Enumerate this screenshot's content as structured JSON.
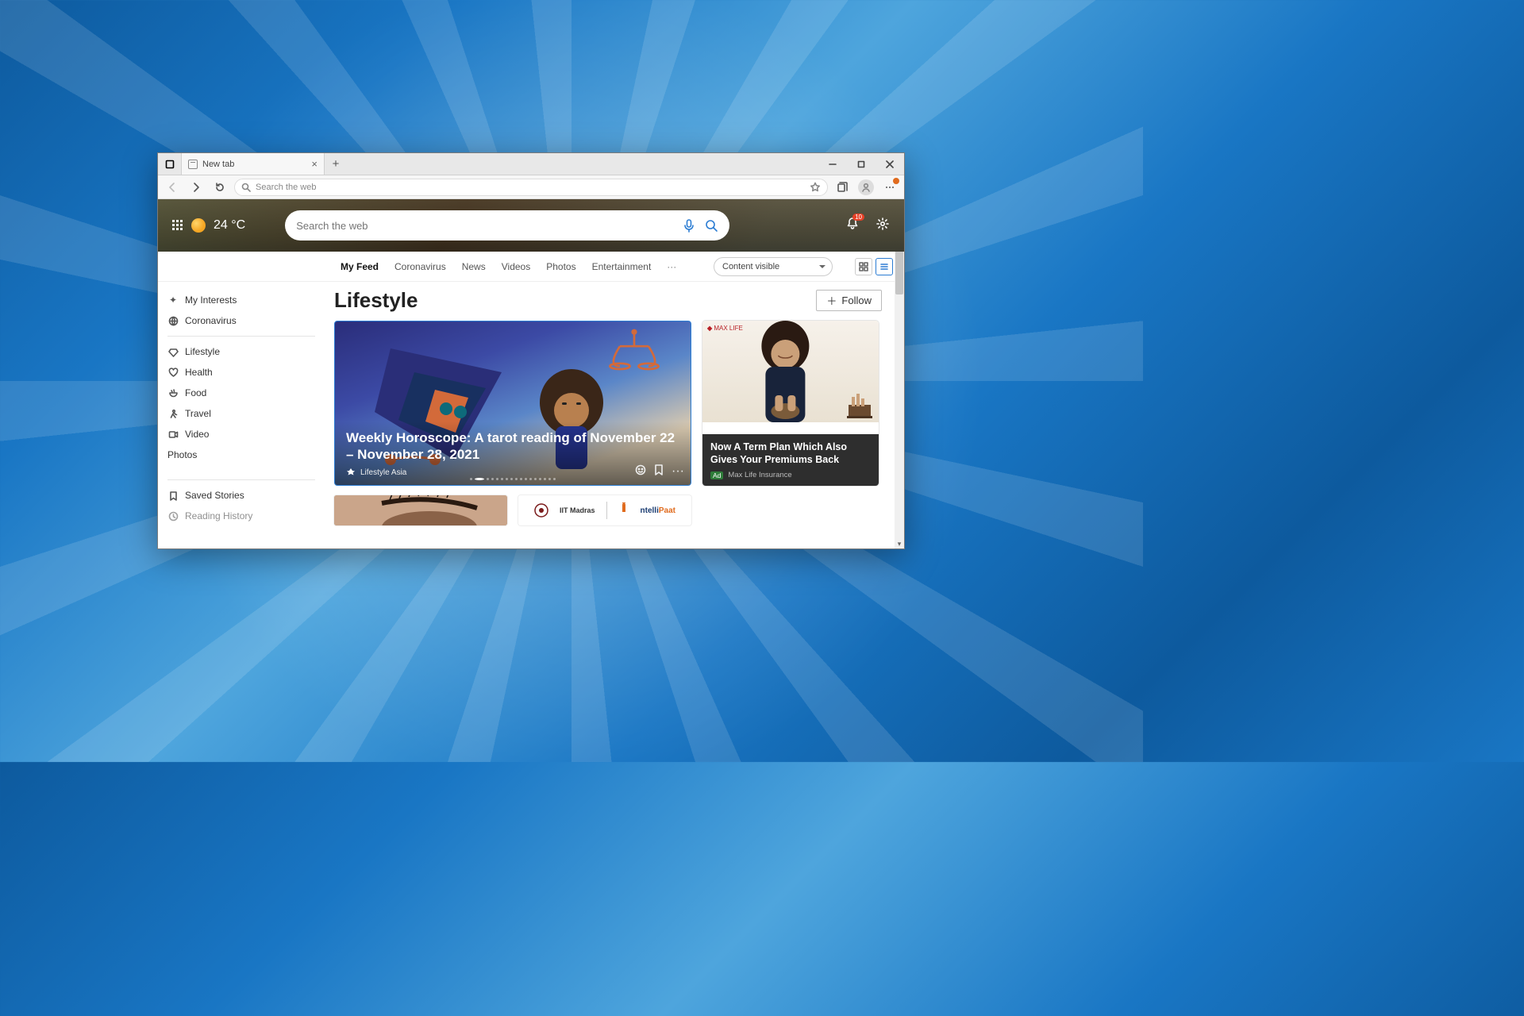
{
  "tab": {
    "title": "New tab"
  },
  "toolbar": {
    "search_placeholder": "Search the web"
  },
  "hero": {
    "temperature": "24 °C",
    "search_placeholder": "Search the web",
    "notification_count": "10"
  },
  "nav": {
    "items": [
      "My Feed",
      "Coronavirus",
      "News",
      "Videos",
      "Photos",
      "Entertainment"
    ],
    "content_dropdown": "Content visible"
  },
  "sidebar": {
    "top": [
      {
        "icon": "sparkle-icon",
        "label": "My Interests"
      },
      {
        "icon": "globe-icon",
        "label": "Coronavirus"
      }
    ],
    "categories": [
      {
        "icon": "diamond-icon",
        "label": "Lifestyle"
      },
      {
        "icon": "heart-icon",
        "label": "Health"
      },
      {
        "icon": "bowl-icon",
        "label": "Food"
      },
      {
        "icon": "person-walk-icon",
        "label": "Travel"
      },
      {
        "icon": "video-icon",
        "label": "Video"
      },
      {
        "icon": "",
        "label": "Photos"
      }
    ],
    "bottom": [
      {
        "icon": "bookmark-icon",
        "label": "Saved Stories"
      },
      {
        "icon": "history-icon",
        "label": "Reading History"
      }
    ]
  },
  "section": {
    "title": "Lifestyle",
    "follow_label": "Follow"
  },
  "hero_card": {
    "headline": "Weekly Horoscope: A tarot reading of November 22 – November 28, 2021",
    "source": "Lifestyle Asia"
  },
  "ad_card": {
    "headline": "Now A Term Plan Which Also Gives Your Premiums Back",
    "badge": "Ad",
    "source": "Max Life Insurance",
    "logo": "MAX LIFE"
  },
  "row2": {
    "iit_label": "IIT Madras",
    "intelli_label_a": "ntelli",
    "intelli_label_b": "Paat"
  }
}
